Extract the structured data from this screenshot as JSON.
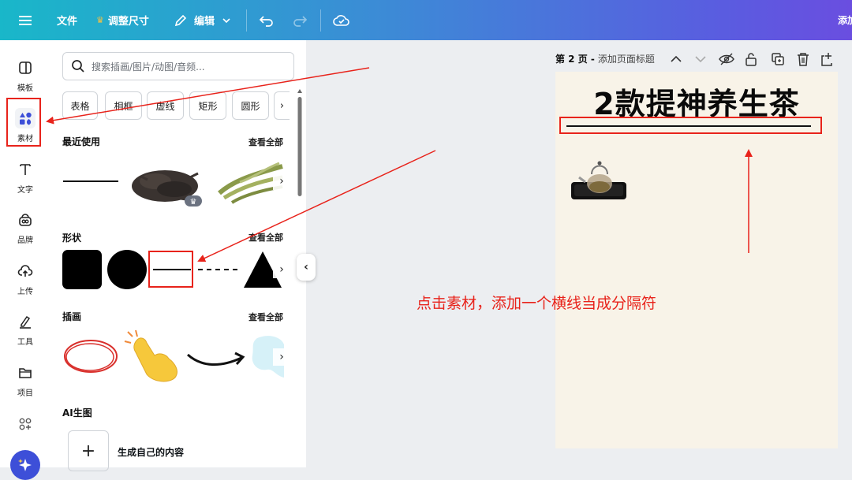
{
  "toolbar": {
    "file_label": "文件",
    "resize_label": "调整尺寸",
    "edit_label": "编辑",
    "right_label": "添加"
  },
  "rail": {
    "items": [
      {
        "label": "模板",
        "icon": "template-icon"
      },
      {
        "label": "素材",
        "icon": "elements-icon",
        "active": true
      },
      {
        "label": "文字",
        "icon": "text-icon"
      },
      {
        "label": "品牌",
        "icon": "brand-icon"
      },
      {
        "label": "上传",
        "icon": "upload-icon"
      },
      {
        "label": "工具",
        "icon": "tools-icon"
      },
      {
        "label": "项目",
        "icon": "folder-icon"
      },
      {
        "label": "",
        "icon": "apps-icon"
      }
    ]
  },
  "panel": {
    "search_placeholder": "搜索插画/图片/动图/音频...",
    "chips": [
      "表格",
      "相框",
      "虚线",
      "矩形",
      "圆形"
    ],
    "recent_title": "最近使用",
    "shapes_title": "形状",
    "illustrations_title": "插画",
    "ai_title": "AI生图",
    "see_all": "查看全部",
    "ai_generate_label": "生成自己的内容"
  },
  "page": {
    "page_label": "第 2 页 - ",
    "add_title_label": "添加页面标题"
  },
  "canvas": {
    "title": "2款提神养生茶"
  },
  "annotation": {
    "text": "点击素材，添加一个横线当成分隔符"
  },
  "colors": {
    "accent": "#5a5ce0",
    "annotation_red": "#e8231b",
    "canvas_bg": "#f8f3e8",
    "crown_gold": "#f5c242"
  }
}
